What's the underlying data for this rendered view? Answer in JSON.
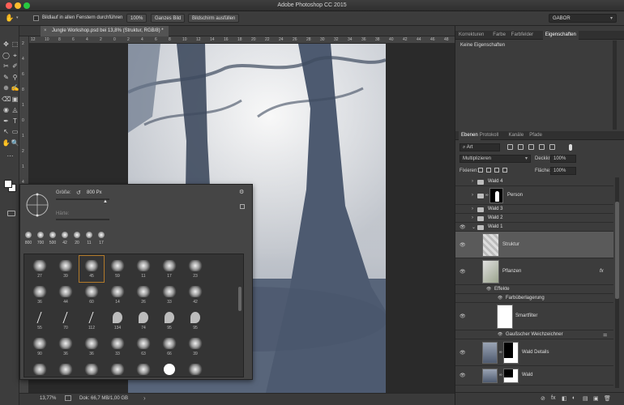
{
  "colors": {
    "canvas_bg": "#535353",
    "panel_bg": "#3c3c3c",
    "active_layer": "#5a5a5a",
    "close": "#ff5f57",
    "minimize": "#febc2e",
    "maximize": "#28c840"
  },
  "window": {
    "title": "Adobe Photoshop CC 2015"
  },
  "options_bar": {
    "scroll_all_label": "Bildlauf in allen Fenstern durchführen",
    "zoom_100": "100%",
    "fit_screen": "Ganzes Bild",
    "fill_screen": "Bildschirm ausfüllen",
    "workspace": "GABOR"
  },
  "document": {
    "tab_title": "Jungle Workshop.psd bei 13,8% (Struktur, RGB/8) *",
    "close_glyph": "×"
  },
  "ruler": {
    "top_ticks": [
      "12",
      "10",
      "8",
      "6",
      "4",
      "2",
      "0",
      "2",
      "4",
      "6",
      "8",
      "10",
      "12",
      "14",
      "16",
      "18",
      "20",
      "22",
      "24",
      "26",
      "28",
      "30",
      "32",
      "34",
      "36",
      "38",
      "40",
      "42",
      "44",
      "46",
      "48"
    ],
    "left_ticks": [
      "2",
      "4",
      "6",
      "8",
      "1",
      "0",
      "1",
      "2",
      "1",
      "4",
      "1",
      "6",
      "1",
      "8",
      "2",
      "0",
      "2",
      "2",
      "2",
      "4",
      "2",
      "6"
    ]
  },
  "status": {
    "zoom": "13,77%",
    "doc_size": "Dok: 66,7 MB/1,00 GB",
    "arrow": "›"
  },
  "brush_panel": {
    "size_label": "Größe:",
    "size_value": "800 Px",
    "hardness_label": "Härte:",
    "gear": "⚙",
    "presets": [
      "800",
      "700",
      "500",
      "42",
      "20",
      "11",
      "17"
    ],
    "brushes": [
      [
        "27",
        "39",
        "45",
        "59",
        "11",
        "17",
        "23"
      ],
      [
        "36",
        "44",
        "60",
        "14",
        "26",
        "33",
        "42"
      ],
      [
        "55",
        "70",
        "112",
        "134",
        "74",
        "95",
        "95"
      ],
      [
        "90",
        "36",
        "36",
        "33",
        "63",
        "66",
        "39"
      ],
      [
        "",
        "",
        "",
        "",
        "",
        "",
        ""
      ]
    ]
  },
  "properties": {
    "tabs": [
      "Korrekturen",
      "Farbe",
      "Farbfelder",
      "Eigenschaften"
    ],
    "active_tab": "Eigenschaften",
    "empty_text": "Keine Eigenschaften"
  },
  "layers": {
    "tabs": [
      "Ebenen",
      "Protokoll",
      "Kanäle",
      "Pfade"
    ],
    "filter_label": "Art",
    "blend_mode": "Multiplizieren",
    "opacity_label": "Deckkraft:",
    "opacity_value": "100%",
    "lock_label": "Fixieren:",
    "fill_label": "Fläche:",
    "fill_value": "100%",
    "items": [
      {
        "name": "Wald 4",
        "kind": "group"
      },
      {
        "name": "Person",
        "kind": "group-mask"
      },
      {
        "name": "Wald 3",
        "kind": "group"
      },
      {
        "name": "Wald 2",
        "kind": "group"
      },
      {
        "name": "Wald 1",
        "kind": "group-open"
      },
      {
        "name": "Struktur",
        "kind": "layer"
      },
      {
        "name": "Pflanzen",
        "kind": "smart"
      },
      {
        "name": "Effekte",
        "kind": "fx"
      },
      {
        "name": "Farbüberlagerung",
        "kind": "fx-item"
      },
      {
        "name": "Smartfilter",
        "kind": "smartfilter"
      },
      {
        "name": "Gaußscher Weichzeichner",
        "kind": "fx-item"
      },
      {
        "name": "Wald Details",
        "kind": "layer-mask"
      },
      {
        "name": "Wald",
        "kind": "layer-mask"
      }
    ],
    "fx_glyph": "fx",
    "footer_glyphs": [
      "⊘",
      "fx",
      "◧",
      "◐",
      "▤",
      "▣",
      "🗑"
    ]
  },
  "tools": {
    "glyphs": [
      "✥",
      "⬚",
      "◯",
      "⌖",
      "✂",
      "✐",
      "✎",
      "⚲",
      "⊕",
      "✍",
      "⌫",
      "▣",
      "◉",
      "◬",
      "✒",
      "T",
      "↖",
      "▭",
      "✋",
      "🔍",
      "⋯"
    ]
  }
}
